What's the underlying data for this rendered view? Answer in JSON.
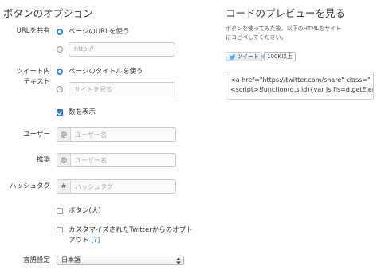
{
  "options": {
    "title": "ボタンのオプション",
    "share_url": {
      "label": "URLを共有",
      "use_page_url": "ページのURLを使う",
      "url_placeholder": "http://"
    },
    "tweet_text": {
      "label_line1": "ツイート内",
      "label_line2": "テキスト",
      "use_page_title": "ページのタイトルを使う",
      "text_placeholder": "サイトを見る"
    },
    "show_count": "数を表示",
    "via": {
      "label": "ユーザー",
      "prefix": "@",
      "placeholder": "ユーザー名"
    },
    "recommend": {
      "label": "推奨",
      "prefix": "@",
      "placeholder": "ユーザー名"
    },
    "hashtag": {
      "label": "ハッシュタグ",
      "prefix": "#",
      "placeholder": "ハッシュタグ"
    },
    "large_button": "ボタン(大)",
    "opt_out_line1": "カスタマイズされたTwitterからのオプト",
    "opt_out_line2": "アウト",
    "opt_out_help": "[?]",
    "language": {
      "label": "言語設定",
      "selected": "日本語"
    }
  },
  "preview": {
    "title": "コードのプレビューを見る",
    "hint_line1": "ボタンを使ってみた後、以下のHTMLをサイト",
    "hint_line2": "にコピペしてください。",
    "tweet_button": "ツイート",
    "count_bubble": "100K以上",
    "code_line1": "<a href=\"https://twitter.com/share\" class=\"",
    "code_line2": "<script>!function(d,s,id){var js,fjs=d.getElem"
  },
  "colors": {
    "accent_radio": "#2f80d8",
    "checkbox_checked": "#3a7fd0",
    "help_link": "#2b7bb9",
    "twitter_bird": "#55acee"
  },
  "icons": {
    "tweet_button_icon": "twitter-bird-icon",
    "select_arrows": "updown-arrows-icon"
  }
}
